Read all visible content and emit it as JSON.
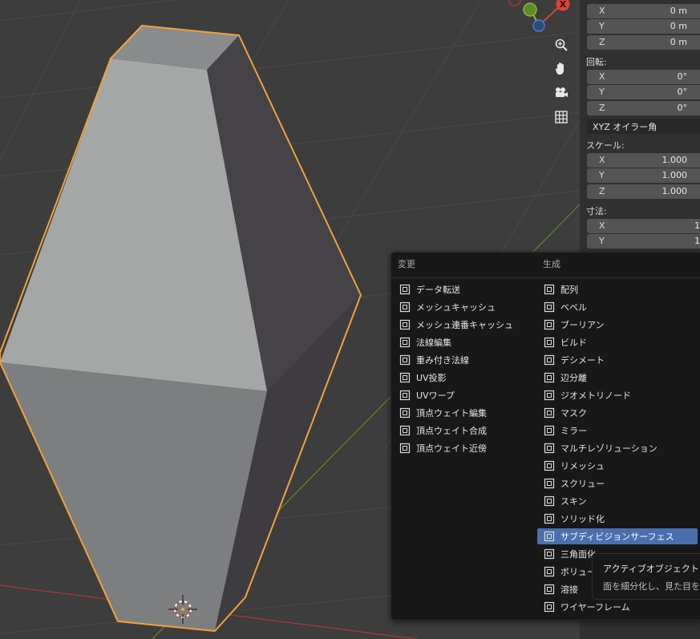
{
  "gizmo": {
    "x_axis_label": "X"
  },
  "properties": {
    "location": [
      {
        "axis": "X",
        "value": "0 m"
      },
      {
        "axis": "Y",
        "value": "0 m"
      },
      {
        "axis": "Z",
        "value": "0 m"
      }
    ],
    "rotation_label": "回転:",
    "rotation": [
      {
        "axis": "X",
        "value": "0°"
      },
      {
        "axis": "Y",
        "value": "0°"
      },
      {
        "axis": "Z",
        "value": "0°"
      }
    ],
    "rotation_mode": "XYZ オイラー角",
    "scale_label": "スケール:",
    "scale": [
      {
        "axis": "X",
        "value": "1.000"
      },
      {
        "axis": "Y",
        "value": "1.000"
      },
      {
        "axis": "Z",
        "value": "1.000"
      }
    ],
    "dimensions_label": "寸法:",
    "dimensions": [
      {
        "axis": "X",
        "value": "1"
      },
      {
        "axis": "Y",
        "value": "1"
      }
    ]
  },
  "modifier_menu": {
    "edit_header": "変更",
    "generate_header": "生成",
    "edit_items": [
      {
        "label": "データ転送",
        "icon": "data-transfer-icon"
      },
      {
        "label": "メッシュキャッシュ",
        "icon": "mesh-cache-icon"
      },
      {
        "label": "メッシュ連番キャッシュ",
        "icon": "mesh-sequence-cache-icon"
      },
      {
        "label": "法線編集",
        "icon": "normal-edit-icon"
      },
      {
        "label": "重み付き法線",
        "icon": "weighted-normal-icon"
      },
      {
        "label": "UV投影",
        "icon": "uv-project-icon"
      },
      {
        "label": "UVワープ",
        "icon": "uv-warp-icon"
      },
      {
        "label": "頂点ウェイト編集",
        "icon": "vertex-weight-edit-icon"
      },
      {
        "label": "頂点ウェイト合成",
        "icon": "vertex-weight-mix-icon"
      },
      {
        "label": "頂点ウェイト近傍",
        "icon": "vertex-weight-proximity-icon"
      }
    ],
    "generate_items": [
      {
        "label": "配列",
        "icon": "array-icon"
      },
      {
        "label": "ベベル",
        "icon": "bevel-icon"
      },
      {
        "label": "ブーリアン",
        "icon": "boolean-icon"
      },
      {
        "label": "ビルド",
        "icon": "build-icon"
      },
      {
        "label": "デシメート",
        "icon": "decimate-icon"
      },
      {
        "label": "辺分離",
        "icon": "edge-split-icon"
      },
      {
        "label": "ジオメトリノード",
        "icon": "geometry-nodes-icon"
      },
      {
        "label": "マスク",
        "icon": "mask-icon"
      },
      {
        "label": "ミラー",
        "icon": "mirror-icon"
      },
      {
        "label": "マルチレゾリューション",
        "icon": "multires-icon"
      },
      {
        "label": "リメッシュ",
        "icon": "remesh-icon"
      },
      {
        "label": "スクリュー",
        "icon": "screw-icon"
      },
      {
        "label": "スキン",
        "icon": "skin-icon"
      },
      {
        "label": "ソリッド化",
        "icon": "solidify-icon"
      },
      {
        "label": "サブディビジョンサーフェス",
        "icon": "subdivision-surface-icon",
        "active": true
      },
      {
        "label": "三角面化",
        "icon": "triangulate-icon"
      },
      {
        "label": "ボリュー",
        "icon": "volume-icon"
      },
      {
        "label": "溶接",
        "icon": "weld-icon"
      },
      {
        "label": "ワイヤーフレーム",
        "icon": "wireframe-icon"
      }
    ]
  },
  "tooltip": {
    "title": "アクティブオブジェクト",
    "description": "面を細分化し、見た目を"
  },
  "colors": {
    "viewport_bg": "#3d3d3d",
    "selection_outline": "#f4a13a",
    "menu_highlight": "#4a6fae",
    "axis_x": "#c33b3b",
    "axis_y": "#6f9a2f"
  }
}
